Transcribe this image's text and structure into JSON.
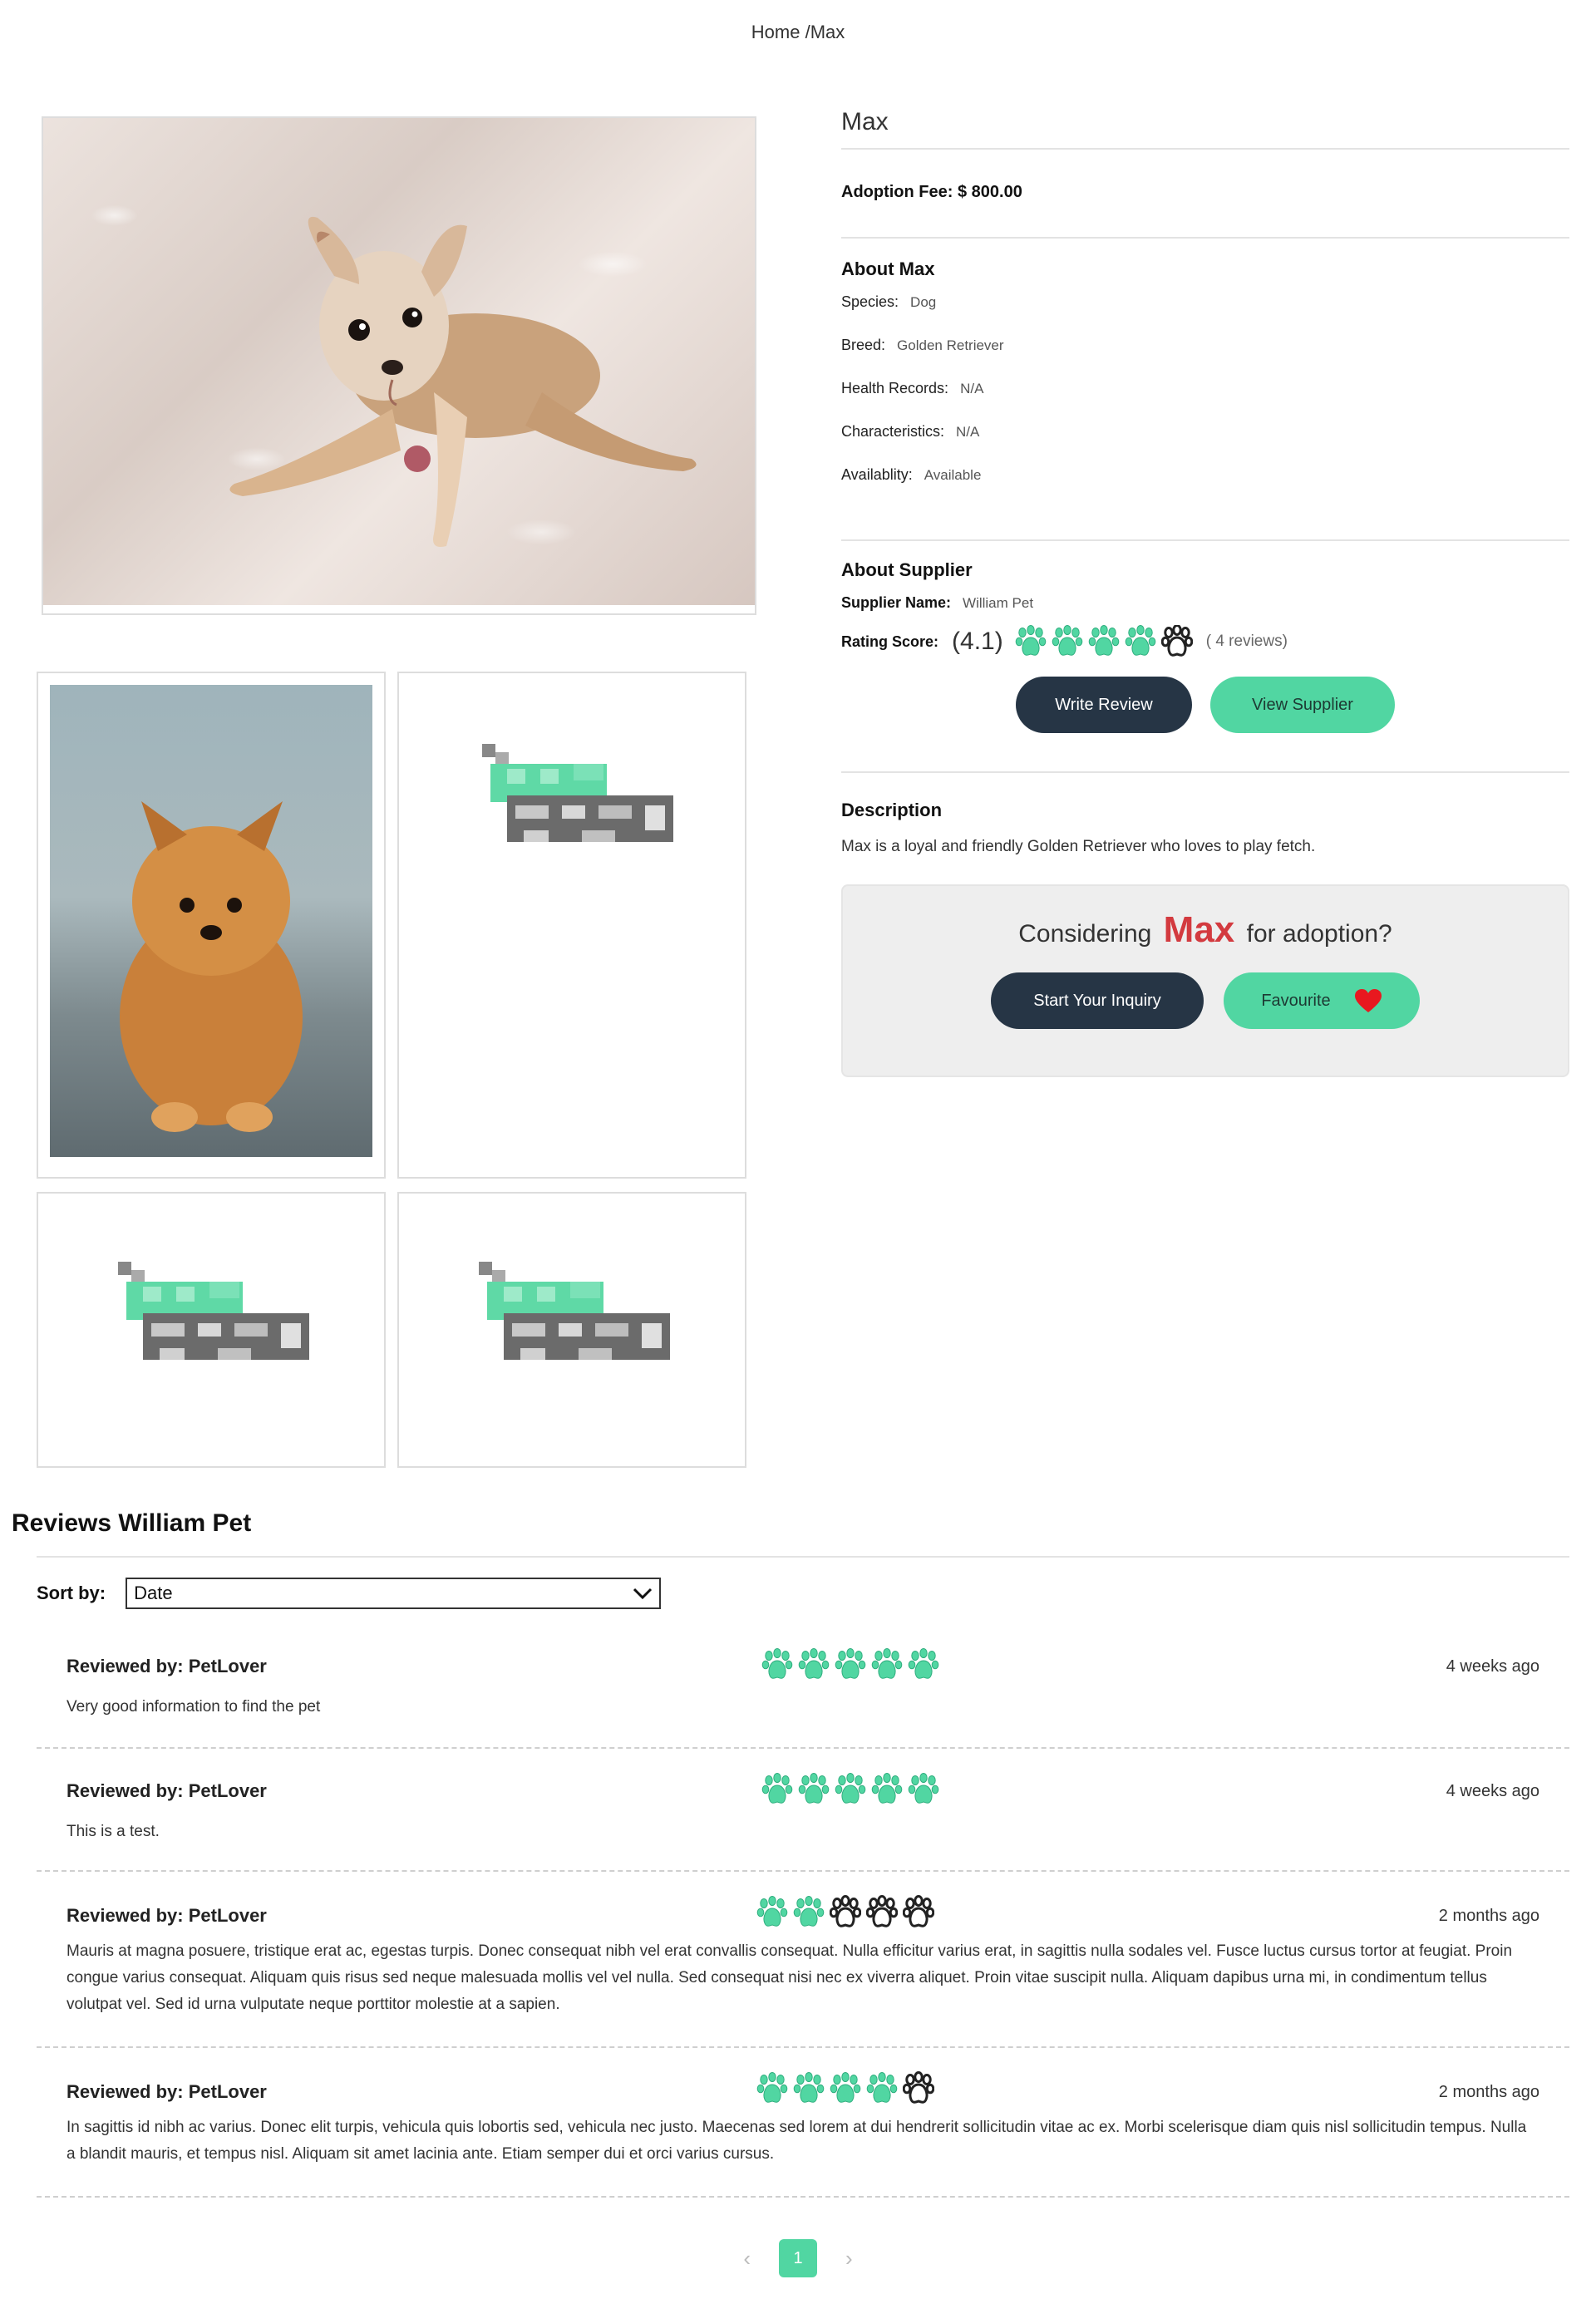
{
  "breadcrumb": {
    "home": "Home",
    "separator": "/",
    "current": "Max"
  },
  "pet": {
    "name": "Max",
    "adoption_fee_label": "Adoption Fee:",
    "adoption_fee_value": "$ 800.00",
    "about_title": "About Max",
    "details": [
      {
        "label": "Species:",
        "value": "Dog"
      },
      {
        "label": "Breed:",
        "value": "Golden Retriever"
      },
      {
        "label": "Health Records:",
        "value": "N/A"
      },
      {
        "label": "Characteristics:",
        "value": "N/A"
      },
      {
        "label": "Availablity:",
        "value": "Available"
      }
    ],
    "description_title": "Description",
    "description": "Max is a loyal and friendly Golden Retriever who loves to play fetch."
  },
  "supplier": {
    "title": "About Supplier",
    "name_label": "Supplier Name:",
    "name": "William Pet",
    "rating_label": "Rating Score:",
    "score": "(4.1)",
    "paws_filled": 4,
    "paws_total": 5,
    "reviews_count": "( 4 reviews)",
    "write_review": "Write Review",
    "view_supplier": "View Supplier"
  },
  "inquiry": {
    "prefix": "Considering",
    "name": "Max",
    "suffix": "for adoption?",
    "start_inquiry": "Start Your Inquiry",
    "favourite": "Favourite"
  },
  "reviews": {
    "title": "Reviews William Pet",
    "sort_label": "Sort by:",
    "sort_value": "Date",
    "items": [
      {
        "by": "Reviewed by: PetLover",
        "paws": 5,
        "when": "4 weeks ago",
        "text": "Very good information to find the pet"
      },
      {
        "by": "Reviewed by: PetLover",
        "paws": 5,
        "when": "4 weeks ago",
        "text": "This is a test."
      },
      {
        "by": "Reviewed by: PetLover",
        "paws": 2,
        "when": "2 months ago",
        "text": "Mauris at magna posuere, tristique erat ac, egestas turpis. Donec consequat nibh vel erat convallis consequat. Nulla efficitur varius erat, in sagittis nulla sodales vel. Fusce luctus cursus tortor at feugiat. Proin congue varius consequat. Aliquam quis risus sed neque malesuada mollis vel vel nulla. Sed consequat nisi nec ex viverra aliquet. Proin vitae suscipit nulla. Aliquam dapibus urna mi, in condimentum tellus volutpat vel. Sed id urna vulputate neque porttitor molestie at a sapien."
      },
      {
        "by": "Reviewed by: PetLover",
        "paws": 4,
        "when": "2 months ago",
        "text": "In sagittis id nibh ac varius. Donec elit turpis, vehicula quis lobortis sed, vehicula nec justo. Maecenas sed lorem at dui hendrerit sollicitudin vitae ac ex. Morbi scelerisque diam quis nisl sollicitudin tempus. Nulla a blandit mauris, et tempus nisl. Aliquam sit amet lacinia ante. Etiam semper dui et orci varius cursus."
      }
    ]
  },
  "pagination": {
    "prev": "‹",
    "current": "1",
    "next": "›"
  },
  "colors": {
    "accent": "#51d6a2",
    "dark": "#263545",
    "heart": "#e8181f",
    "name_red": "#d33a3f",
    "paw_empty": "#222222"
  }
}
